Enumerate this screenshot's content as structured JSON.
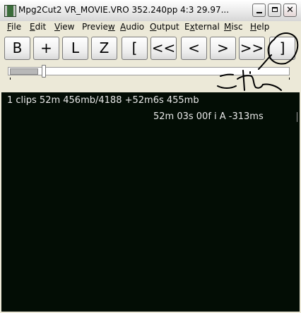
{
  "titlebar": {
    "title": "Mpg2Cut2  VR_MOVIE.VRO   352.240pp 4:3   29.97..."
  },
  "menu": {
    "items": [
      {
        "key": "F",
        "rest": "ile"
      },
      {
        "key": "E",
        "rest": "dit"
      },
      {
        "key": "V",
        "rest": "iew"
      },
      {
        "key": "",
        "rest": "Previe",
        "key2": "w"
      },
      {
        "key": "A",
        "rest": "udio"
      },
      {
        "key": "O",
        "rest": "utput"
      },
      {
        "key": "",
        "rest": "E",
        "key2": "x",
        "rest2": "ternal"
      },
      {
        "key": "M",
        "rest": "isc"
      },
      {
        "key": "H",
        "rest": "elp"
      }
    ]
  },
  "toolbar": {
    "buttons": [
      "B",
      "+",
      "L",
      "Z",
      "[",
      "<<",
      "<",
      ">",
      ">>",
      "]"
    ]
  },
  "info": {
    "line1": "1 clips 52m    456mb/4188    +52m6s 455mb",
    "line2": "52m 03s 00f i    A -313ms"
  },
  "annotation": {
    "text": "これ",
    "color": "#000000"
  },
  "colors": {
    "panel_bg": "#030d05",
    "panel_text": "#e8e8e8",
    "window_bg": "#ece9d8"
  }
}
